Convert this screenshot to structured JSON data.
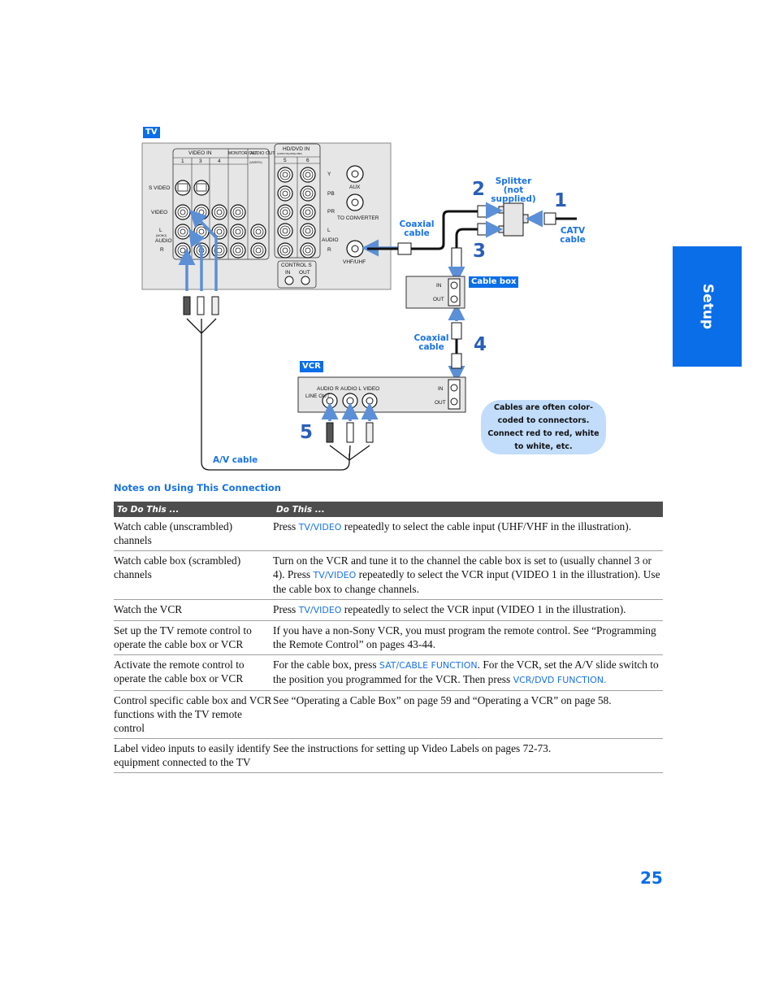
{
  "diagram": {
    "tv_tag": "TV",
    "vcr_tag": "VCR",
    "cable_box_tag": "Cable box",
    "tv_panel": {
      "video_in_header": "VIDEO IN",
      "video_in_columns": [
        "1",
        "3",
        "4"
      ],
      "monitor_out": "MONITOR OUT",
      "audio_out": "AUDIO OUT",
      "audio_out_sub": "(VAR/FIX)",
      "row_labels": [
        "S VIDEO",
        "VIDEO",
        "L",
        "(MONO)",
        "AUDIO",
        "R"
      ],
      "hd_dvd_in": "HD/DVD IN",
      "hd_dvd_sub": "(1080i/720p/480p/480i)",
      "hd_columns": [
        "5",
        "6"
      ],
      "hd_row_labels": [
        "Y",
        "PB",
        "PR",
        "L",
        "AUDIO",
        "R"
      ],
      "aux": "AUX",
      "to_converter": "TO CONVERTER",
      "vhf_uhf": "VHF/UHF",
      "control_s": "CONTROL S",
      "control_s_ports": [
        "IN",
        "OUT"
      ]
    },
    "cable_box_ports": [
      "IN",
      "OUT"
    ],
    "vcr_panel": {
      "line_out": "LINE OUT",
      "ports": [
        "AUDIO R",
        "AUDIO L",
        "VIDEO"
      ],
      "rf_ports": [
        "IN",
        "OUT"
      ]
    },
    "labels": {
      "splitter": "Splitter",
      "splitter_sub": "(not supplied)",
      "coaxial_cable_1": "Coaxial cable",
      "coaxial_cable_2": "Coaxial cable",
      "catv_cable": "CATV cable",
      "av_cable": "A/V cable"
    },
    "steps": [
      "1",
      "2",
      "3",
      "4",
      "5"
    ],
    "note": "Cables are often color-coded to connectors. Connect red to red, white to white, etc."
  },
  "side_tab": "Setup",
  "notes": {
    "heading": "Notes on Using This Connection",
    "columns": [
      "To Do This ...",
      "Do This ..."
    ],
    "rows": [
      {
        "task": "Watch cable (unscrambled) channels",
        "parts": [
          {
            "t": "Press "
          },
          {
            "k": "TV/VIDEO"
          },
          {
            "t": " repeatedly to select the cable input (UHF/VHF in the illustration)."
          }
        ]
      },
      {
        "task": "Watch cable box (scrambled) channels",
        "parts": [
          {
            "t": "Turn on the VCR and tune it to the channel the cable box is set to (usually channel 3 or 4). Press "
          },
          {
            "k": "TV/VIDEO"
          },
          {
            "t": " repeatedly to select the VCR input (VIDEO 1 in the illustration). Use the cable box to change channels."
          }
        ]
      },
      {
        "task": "Watch the VCR",
        "parts": [
          {
            "t": "Press "
          },
          {
            "k": "TV/VIDEO"
          },
          {
            "t": " repeatedly to select the VCR input (VIDEO 1 in the illustration)."
          }
        ]
      },
      {
        "task": "Set up the TV remote control to operate the cable box or VCR",
        "parts": [
          {
            "t": "If you have a non-Sony VCR, you must program the remote control. See “Programming the Remote Control” on pages 43-44."
          }
        ]
      },
      {
        "task": "Activate the remote control to operate the cable box or VCR",
        "parts": [
          {
            "t": "For the cable box, press "
          },
          {
            "k": "SAT/CABLE FUNCTION"
          },
          {
            "t": ". For the VCR, set the A/V slide switch to the position you programmed for the VCR. Then press "
          },
          {
            "k": "VCR/DVD FUNCTION."
          }
        ]
      },
      {
        "task": "Control specific cable box and VCR functions with the TV remote control",
        "parts": [
          {
            "t": "See “Operating a Cable Box” on page 59 and “Operating a VCR” on page 58."
          }
        ]
      },
      {
        "task": "Label video inputs to easily identify equipment connected to the TV",
        "parts": [
          {
            "t": "See the instructions for setting up Video Labels on pages 72-73."
          }
        ]
      }
    ]
  },
  "page_number": "25",
  "colors": {
    "accent": "#0a6ee8",
    "link_text": "#1873e6",
    "arrow": "#5b8fd6",
    "header_bg": "#4d4d4d",
    "note_bubble": "#c2dcfb",
    "panel_bg": "#e6e6e6"
  }
}
